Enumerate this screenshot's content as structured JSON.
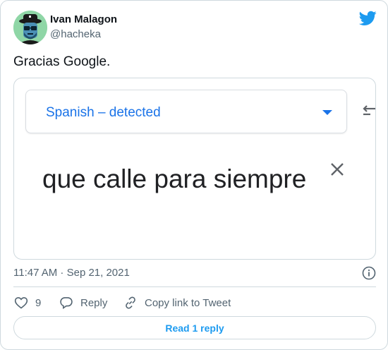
{
  "author": {
    "name": "Ivan Malagon",
    "handle": "@hacheka"
  },
  "tweet": {
    "text": "Gracias Google."
  },
  "media": {
    "language_label": "Spanish – detected",
    "source_text": "que calle para siempre"
  },
  "meta": {
    "timestamp": "11:47 AM · Sep 21, 2021"
  },
  "actions": {
    "like_count": "9",
    "reply_label": "Reply",
    "copy_label": "Copy link to Tweet"
  },
  "read_reply_label": "Read 1 reply",
  "colors": {
    "twitter_blue": "#1d9bf0",
    "google_blue": "#1a73e8",
    "muted": "#536471",
    "border": "#cfd9de",
    "avatar_bg": "#8fd6a6"
  },
  "icons": [
    "twitter-logo-icon",
    "swap-languages-icon",
    "clear-icon",
    "info-icon",
    "heart-icon",
    "reply-icon",
    "link-icon"
  ]
}
